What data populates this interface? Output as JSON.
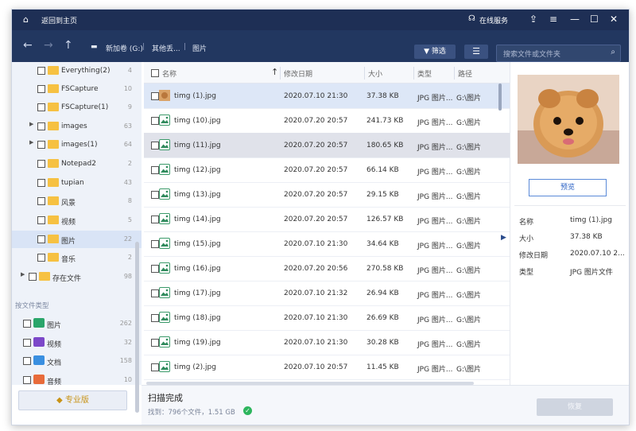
{
  "titlebar": {
    "back_home": "返回到主页",
    "online_service": "在线服务"
  },
  "toolbar": {
    "crumbs": [
      "新加卷 (G:)",
      "其他丢...",
      "图片"
    ],
    "filter_label": "筛选",
    "search_placeholder": "搜索文件或文件夹"
  },
  "sidebar": {
    "folders": [
      {
        "label": "Everything(2)",
        "count": "4"
      },
      {
        "label": "FSCapture",
        "count": "10"
      },
      {
        "label": "FSCapture(1)",
        "count": "9"
      },
      {
        "label": "images",
        "count": "63"
      },
      {
        "label": "images(1)",
        "count": "64"
      },
      {
        "label": "Notepad2",
        "count": "2"
      },
      {
        "label": "tupian",
        "count": "43"
      },
      {
        "label": "风景",
        "count": "8"
      },
      {
        "label": "视频",
        "count": "5"
      },
      {
        "label": "图片",
        "count": "22"
      },
      {
        "label": "音乐",
        "count": "2"
      },
      {
        "label": "存在文件",
        "count": "98"
      }
    ],
    "types_heading": "按文件类型",
    "types": [
      {
        "label": "图片",
        "count": "262"
      },
      {
        "label": "视频",
        "count": "32"
      },
      {
        "label": "文档",
        "count": "158"
      },
      {
        "label": "音频",
        "count": "10"
      }
    ],
    "pro_label": "专业版"
  },
  "table": {
    "headers": {
      "name": "名称",
      "date": "修改日期",
      "size": "大小",
      "type": "类型",
      "path": "路径"
    },
    "rows": [
      {
        "name": "timg (1).jpg",
        "date": "2020.07.10 21:30",
        "size": "37.38 KB",
        "type": "JPG 图片...",
        "path": "G:\\图片"
      },
      {
        "name": "timg (10).jpg",
        "date": "2020.07.20 20:57",
        "size": "241.73 KB",
        "type": "JPG 图片...",
        "path": "G:\\图片"
      },
      {
        "name": "timg (11).jpg",
        "date": "2020.07.20 20:57",
        "size": "180.65 KB",
        "type": "JPG 图片...",
        "path": "G:\\图片"
      },
      {
        "name": "timg (12).jpg",
        "date": "2020.07.20 20:57",
        "size": "66.14 KB",
        "type": "JPG 图片...",
        "path": "G:\\图片"
      },
      {
        "name": "timg (13).jpg",
        "date": "2020.07.20 20:57",
        "size": "29.15 KB",
        "type": "JPG 图片...",
        "path": "G:\\图片"
      },
      {
        "name": "timg (14).jpg",
        "date": "2020.07.20 20:57",
        "size": "126.57 KB",
        "type": "JPG 图片...",
        "path": "G:\\图片"
      },
      {
        "name": "timg (15).jpg",
        "date": "2020.07.10 21:30",
        "size": "34.64 KB",
        "type": "JPG 图片...",
        "path": "G:\\图片"
      },
      {
        "name": "timg (16).jpg",
        "date": "2020.07.20 20:56",
        "size": "270.58 KB",
        "type": "JPG 图片...",
        "path": "G:\\图片"
      },
      {
        "name": "timg (17).jpg",
        "date": "2020.07.10 21:32",
        "size": "26.94 KB",
        "type": "JPG 图片...",
        "path": "G:\\图片"
      },
      {
        "name": "timg (18).jpg",
        "date": "2020.07.10 21:30",
        "size": "26.69 KB",
        "type": "JPG 图片...",
        "path": "G:\\图片"
      },
      {
        "name": "timg (19).jpg",
        "date": "2020.07.10 21:30",
        "size": "30.28 KB",
        "type": "JPG 图片...",
        "path": "G:\\图片"
      },
      {
        "name": "timg (2).jpg",
        "date": "2020.07.10 20:57",
        "size": "11.45 KB",
        "type": "JPG 图片...",
        "path": "G:\\图片"
      }
    ]
  },
  "preview": {
    "button_label": "预览",
    "props": [
      {
        "label": "名称",
        "value": "timg (1).jpg"
      },
      {
        "label": "大小",
        "value": "37.38 KB"
      },
      {
        "label": "修改日期",
        "value": "2020.07.10 2..."
      },
      {
        "label": "类型",
        "value": "JPG 图片文件"
      }
    ]
  },
  "footer": {
    "status": "扫描完成",
    "found": "找到：796个文件，1.51 GB",
    "recover_label": "恢复"
  },
  "colors": {
    "titlebar": "#1e2f55",
    "toolbar": "#223760",
    "accent": "#2c63c5",
    "folder": "#f6c142",
    "success": "#2db55d"
  }
}
